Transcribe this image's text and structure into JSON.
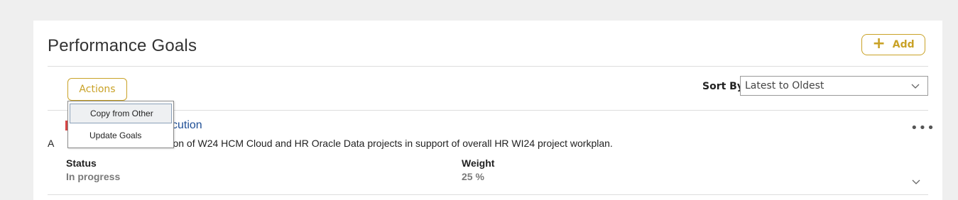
{
  "section": {
    "title": "Performance Goals",
    "add_label": "Add"
  },
  "toolbar": {
    "actions_label": "Actions",
    "sort_label": "Sort By",
    "sort_value": "Latest to Oldest"
  },
  "actions_menu": {
    "items": [
      {
        "label": "Copy from Other"
      },
      {
        "label": "Update Goals"
      }
    ]
  },
  "goal": {
    "title_visible": "cution",
    "description_start": "A",
    "description_visible": "ion of W24 HCM Cloud and HR Oracle Data projects in support of overall HR WI24 project workplan.",
    "status_label": "Status",
    "status_value": "In progress",
    "weight_label": "Weight",
    "weight_value": "25 %",
    "more_glyph": "•••"
  },
  "colors": {
    "accent": "#c9a227",
    "link": "#1f4f96",
    "background": "#efefef"
  },
  "icons": [
    "plus-icon",
    "chevron-down-icon",
    "more-options-icon",
    "expand-chevron-icon"
  ]
}
